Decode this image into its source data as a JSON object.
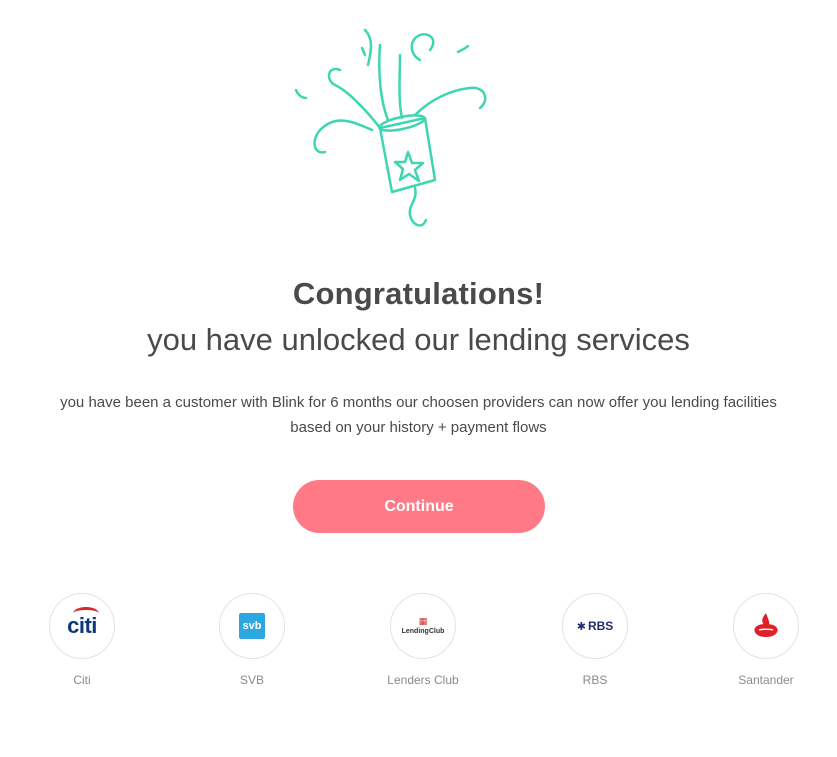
{
  "hero": {
    "title": "Congratulations!",
    "subtitle": "you have unlocked our lending services",
    "description": "you have been a customer with Blink for 6 months our choosen providers can now offer you lending facilities based on your history + payment flows",
    "illustration_icon": "party-popper-icon"
  },
  "cta": {
    "label": "Continue"
  },
  "providers": [
    {
      "name": "Citi",
      "logo_text": "citi",
      "icon": "citi-logo"
    },
    {
      "name": "SVB",
      "logo_text": "svb",
      "icon": "svb-logo"
    },
    {
      "name": "Lenders Club",
      "logo_text": "LendingClub",
      "icon": "lendingclub-logo"
    },
    {
      "name": "RBS",
      "logo_text": "RBS",
      "icon": "rbs-logo"
    },
    {
      "name": "Santander",
      "logo_text": "",
      "icon": "santander-logo"
    }
  ],
  "colors": {
    "accent": "#ff7a86",
    "illustration": "#3ed6b0",
    "text": "#4a4a4a",
    "muted": "#8a8a8a"
  }
}
